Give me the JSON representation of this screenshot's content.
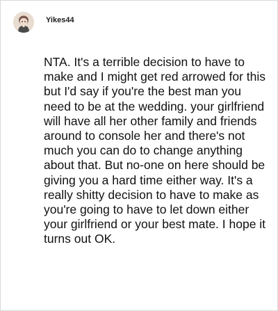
{
  "comment": {
    "username": "Yikes44",
    "avatar_icon": "snoo-avatar-icon",
    "body": "NTA. It's a terrible decision to have to make and I might get red arrowed for this but I'd say if you're the best man you need to be at the wedding. your girlfriend will have all her other family and friends around to console her and there's not much you can do to change anything about that. But no-one on here should be giving you a hard time either way. It's a really shitty decision to have to make as you're going to have to let down either your girlfriend or your best mate. I hope it turns out OK."
  }
}
